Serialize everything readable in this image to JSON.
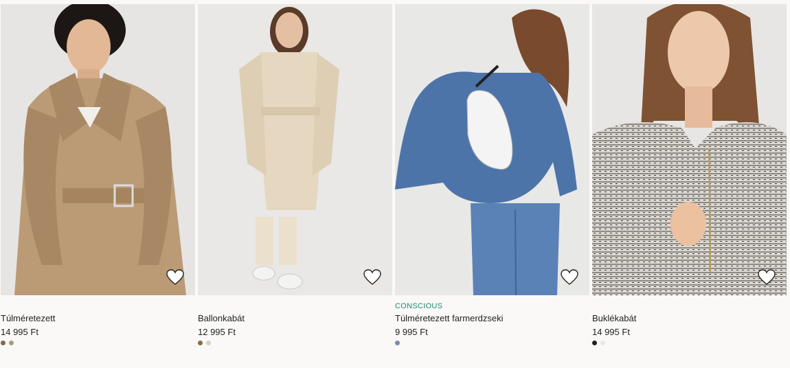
{
  "products": [
    {
      "name": "Túlméretezett",
      "price": "14 995 Ft",
      "badge": "",
      "swatches": [
        "#8a6a48",
        "#a89c84"
      ]
    },
    {
      "name": "Ballonkabát",
      "price": "12 995 Ft",
      "badge": "",
      "swatches": [
        "#8a6a48",
        "#d8d2c2"
      ]
    },
    {
      "name": "Túlméretezett farmerdzseki",
      "price": "9 995 Ft",
      "badge": "CONSCIOUS",
      "swatches": [
        "#7a8ab0"
      ]
    },
    {
      "name": "Buklékabát",
      "price": "14 995 Ft",
      "badge": "",
      "swatches": [
        "#222222",
        "#ece7de"
      ]
    }
  ],
  "icons": {
    "favorite": "heart-outline-icon"
  }
}
